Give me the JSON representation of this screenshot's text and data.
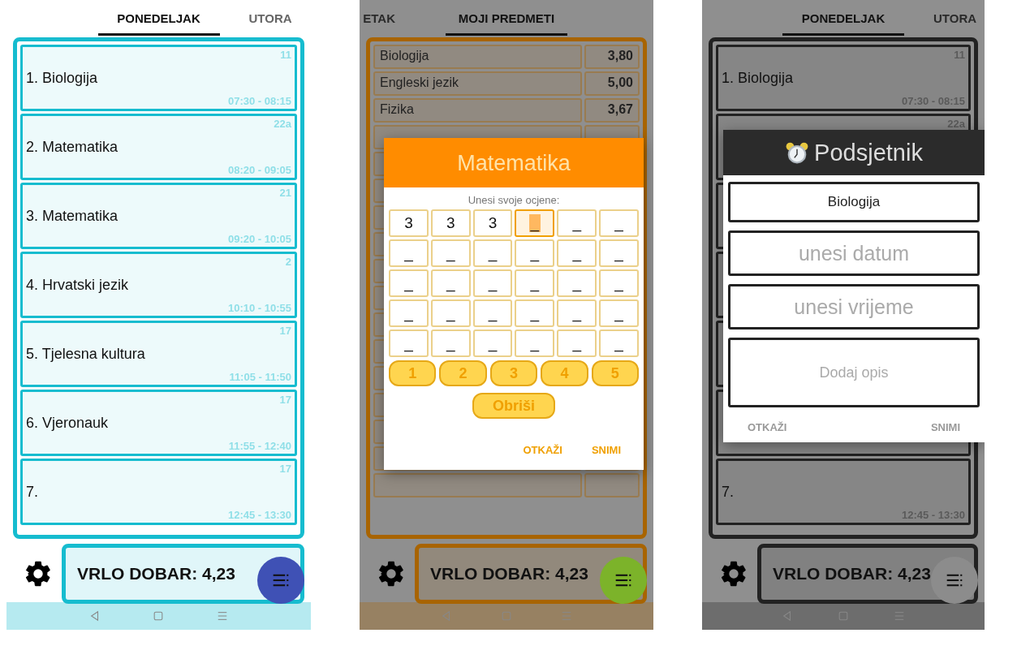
{
  "phones": [
    {
      "kind": "schedule",
      "color": "#16bccf",
      "fab": {
        "color": "#3f51b5"
      },
      "tabs": [
        {
          "label": "PONEDELJAK",
          "selected": true
        },
        {
          "label": "UTORA",
          "selected": false
        }
      ],
      "lessons": [
        {
          "name": "1. Biologija",
          "room": "11",
          "time": "07:30 - 08:15"
        },
        {
          "name": "2. Matematika",
          "room": "22a",
          "time": "08:20 - 09:05"
        },
        {
          "name": "3. Matematika",
          "room": "21",
          "time": "09:20 - 10:05"
        },
        {
          "name": "4. Hrvatski jezik",
          "room": "2",
          "time": "10:10 - 10:55"
        },
        {
          "name": "5. Tjelesna kultura",
          "room": "17",
          "time": "11:05 - 11:50"
        },
        {
          "name": "6. Vjeronauk",
          "room": "17",
          "time": "11:55 - 12:40"
        },
        {
          "name": "7.",
          "room": "17",
          "time": "12:45 - 13:30"
        }
      ],
      "average": "VRLO DOBAR: 4,23"
    },
    {
      "kind": "subjects",
      "color": "#a86400",
      "fab": {
        "color": "#7cb32a"
      },
      "tabs": [
        {
          "label": "ETAK",
          "selected": false
        },
        {
          "label": "MOJI PREDMETI",
          "selected": true
        }
      ],
      "subjects": [
        {
          "name": "Biologija",
          "average": "3,80"
        },
        {
          "name": "Engleski jezik",
          "average": "5,00"
        },
        {
          "name": "Fizika",
          "average": "3,67"
        }
      ],
      "average": "VRLO DOBAR: 4,23",
      "dialog": {
        "kind": "grades",
        "title": "Matematika",
        "prompt": "Unesi svoje ocjene:",
        "grid": [
          [
            {
              "text": "3",
              "selected": false
            },
            {
              "text": "3",
              "selected": false
            },
            {
              "text": "3",
              "selected": false
            },
            {
              "text": "_",
              "selected": true
            },
            {
              "text": "_",
              "selected": false
            },
            {
              "text": "_",
              "selected": false
            }
          ],
          [
            {
              "text": "_",
              "selected": false
            },
            {
              "text": "_",
              "selected": false
            },
            {
              "text": "_",
              "selected": false
            },
            {
              "text": "_",
              "selected": false
            },
            {
              "text": "_",
              "selected": false
            },
            {
              "text": "_",
              "selected": false
            }
          ],
          [
            {
              "text": "_",
              "selected": false
            },
            {
              "text": "_",
              "selected": false
            },
            {
              "text": "_",
              "selected": false
            },
            {
              "text": "_",
              "selected": false
            },
            {
              "text": "_",
              "selected": false
            },
            {
              "text": "_",
              "selected": false
            }
          ],
          [
            {
              "text": "_",
              "selected": false
            },
            {
              "text": "_",
              "selected": false
            },
            {
              "text": "_",
              "selected": false
            },
            {
              "text": "_",
              "selected": false
            },
            {
              "text": "_",
              "selected": false
            },
            {
              "text": "_",
              "selected": false
            }
          ],
          [
            {
              "text": "_",
              "selected": false
            },
            {
              "text": "_",
              "selected": false
            },
            {
              "text": "_",
              "selected": false
            },
            {
              "text": "_",
              "selected": false
            },
            {
              "text": "_",
              "selected": false
            },
            {
              "text": "_",
              "selected": false
            }
          ]
        ],
        "keys": [
          "1",
          "2",
          "3",
          "4",
          "5"
        ],
        "delete": "Obriši",
        "actions": [
          "OTKAŽI",
          "SNIMI"
        ]
      }
    },
    {
      "kind": "schedule",
      "color": "#222222",
      "fab": {
        "color": "#8c8c8c"
      },
      "tabs": [
        {
          "label": "PONEDELJAK",
          "selected": true
        },
        {
          "label": "UTORA",
          "selected": false
        }
      ],
      "lessons": [
        {
          "kind": "lesson",
          "name": "1. Biologija",
          "room": "11",
          "time": "07:30 - 08:15"
        },
        {
          "kind": "lesson",
          "room": "22a"
        },
        {
          "kind": "covered"
        },
        {
          "kind": "covered"
        },
        {
          "kind": "covered"
        },
        {
          "kind": "covered"
        },
        {
          "kind": "lesson",
          "name": "7.",
          "time": "12:45 - 13:30"
        }
      ],
      "average": "VRLO DOBAR: 4,23",
      "dialog": {
        "kind": "reminder",
        "title": "Podsjetnik",
        "fields": [
          {
            "kind": "value",
            "value": "Biologija"
          },
          {
            "kind": "input",
            "placeholder": "unesi datum"
          },
          {
            "kind": "input",
            "placeholder": "unesi vrijeme"
          },
          {
            "kind": "area",
            "placeholder": "Dodaj opis"
          }
        ],
        "actions": [
          "OTKAŽI",
          "SNIMI"
        ]
      }
    }
  ]
}
